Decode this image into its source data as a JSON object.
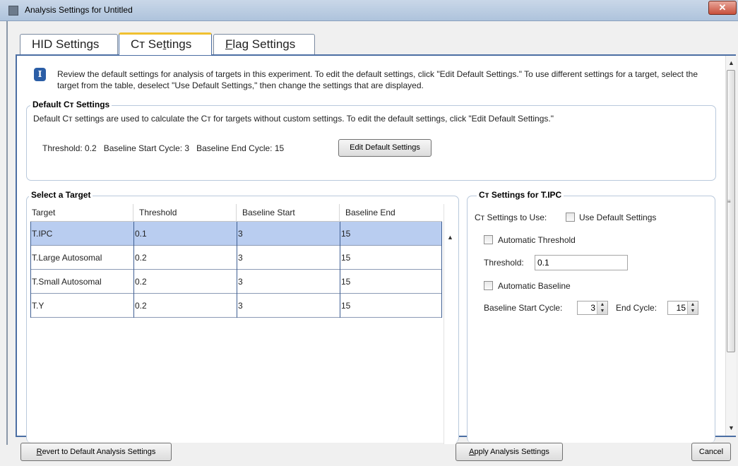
{
  "window": {
    "title": "Analysis Settings for Untitled",
    "close_icon": "close-icon"
  },
  "tabs": [
    {
      "label_pre": "HID Settings",
      "label_u": "",
      "label_post": "",
      "active": false
    },
    {
      "label_pre": "Cт Se",
      "label_u": "t",
      "label_post": "tings",
      "active": true
    },
    {
      "label_pre": "",
      "label_u": "F",
      "label_post": "lag Settings",
      "active": false
    }
  ],
  "info": {
    "icon": "info-icon",
    "text": "Review the default settings for analysis of targets in this experiment. To edit the default settings, click \"Edit Default Settings.\" To use different settings for a target, select the target from the table, deselect \"Use Default Settings,\" then change the settings that are displayed."
  },
  "default_settings": {
    "title": "Default Cт Settings",
    "description": "Default Cт settings are used to calculate the Cт for targets without custom settings. To edit the default settings, click \"Edit Default Settings.\"",
    "summary": "Threshold: 0.2   Baseline Start Cycle: 3   Baseline End Cycle: 15",
    "edit_button": "Edit Default Settings"
  },
  "target_table": {
    "title": "Select a Target",
    "columns": [
      "Target",
      "Threshold",
      "Baseline Start",
      "Baseline End"
    ],
    "rows": [
      {
        "target": "T.IPC",
        "threshold": "0.1",
        "baseline_start": "3",
        "baseline_end": "15",
        "selected": true
      },
      {
        "target": "T.Large Autosomal",
        "threshold": "0.2",
        "baseline_start": "3",
        "baseline_end": "15",
        "selected": false
      },
      {
        "target": "T.Small Autosomal",
        "threshold": "0.2",
        "baseline_start": "3",
        "baseline_end": "15",
        "selected": false
      },
      {
        "target": "T.Y",
        "threshold": "0.2",
        "baseline_start": "3",
        "baseline_end": "15",
        "selected": false
      }
    ]
  },
  "ct_settings": {
    "title": "Cт Settings for T.IPC",
    "use_label": "Cт Settings to Use:",
    "use_default_label": "Use Default Settings",
    "use_default_checked": false,
    "auto_threshold_label": "Automatic Threshold",
    "auto_threshold_checked": false,
    "threshold_label": "Threshold:",
    "threshold_value": "0.1",
    "auto_baseline_label": "Automatic Baseline",
    "auto_baseline_checked": false,
    "baseline_start_label": "Baseline Start Cycle:",
    "baseline_start_value": "3",
    "end_cycle_label": "End Cycle:",
    "end_cycle_value": "15"
  },
  "footer": {
    "revert_pre": "",
    "revert_u": "R",
    "revert_post": "evert to Default Analysis Settings",
    "apply_pre": "",
    "apply_u": "A",
    "apply_post": "pply Analysis Settings",
    "cancel": "Cancel"
  }
}
